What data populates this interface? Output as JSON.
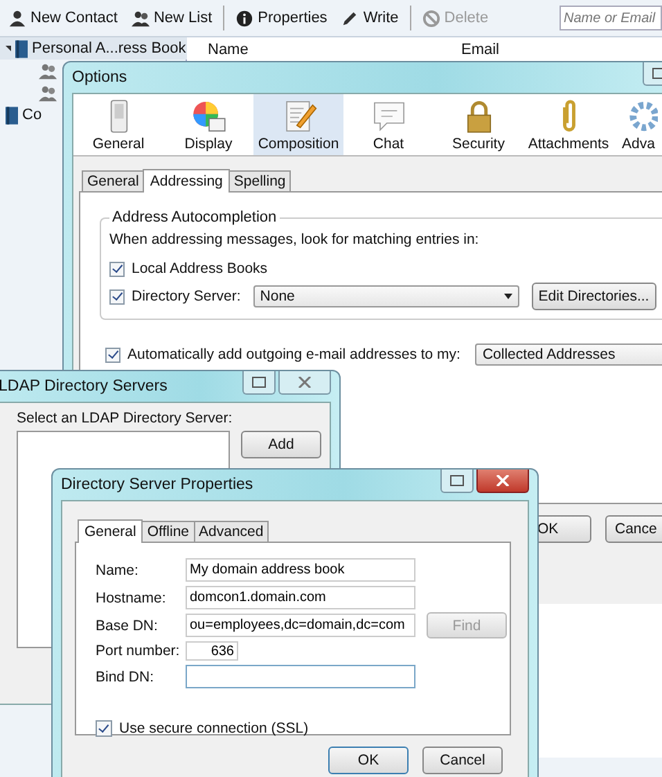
{
  "address_book": {
    "toolbar": [
      {
        "label": "New Contact",
        "disabled": false
      },
      {
        "label": "New List",
        "disabled": false
      },
      {
        "label": "Properties",
        "disabled": false
      },
      {
        "label": "Write",
        "disabled": false
      },
      {
        "label": "Delete",
        "disabled": true
      }
    ],
    "search": {
      "placeholder": "Name or Email"
    },
    "tree": [
      {
        "label": "Personal A...ress Book",
        "selected": true,
        "children": [
          {
            "kind": "list"
          },
          {
            "kind": "list"
          }
        ]
      },
      {
        "label": "Co",
        "selected": false
      }
    ],
    "columns": [
      "Name",
      "Email"
    ]
  },
  "options": {
    "title": "Options",
    "panes": [
      {
        "label": "General",
        "selected": false
      },
      {
        "label": "Display",
        "selected": false
      },
      {
        "label": "Composition",
        "selected": true
      },
      {
        "label": "Chat",
        "selected": false
      },
      {
        "label": "Security",
        "selected": false
      },
      {
        "label": "Attachments",
        "selected": false
      },
      {
        "label": "Adva",
        "selected": false
      }
    ],
    "tabs": [
      {
        "label": "General",
        "selected": false
      },
      {
        "label": "Addressing",
        "selected": true
      },
      {
        "label": "Spelling",
        "selected": false
      }
    ],
    "group": "Address Autocompletion",
    "prompt": "When addressing messages, look for matching entries in:",
    "local_books": {
      "label": "Local Address Books",
      "checked": true
    },
    "directory_server": {
      "label": "Directory Server:",
      "checked": true,
      "value": "None"
    },
    "edit_button": "Edit Directories...",
    "auto_add": {
      "label": "Automatically add outgoing e-mail addresses to my:",
      "checked": true,
      "value": "Collected Addresses"
    },
    "buttons": [
      "OK",
      "Cance"
    ]
  },
  "ldap": {
    "title": "LDAP Directory Servers",
    "label": "Select an LDAP Directory Server:",
    "buttons": [
      "Add"
    ]
  },
  "properties": {
    "title": "Directory Server Properties",
    "tabs": [
      {
        "label": "General",
        "selected": true
      },
      {
        "label": "Offline",
        "selected": false
      },
      {
        "label": "Advanced",
        "selected": false
      }
    ],
    "fields": [
      {
        "label": "Name:",
        "value": "My domain address book"
      },
      {
        "label": "Hostname:",
        "value": "domcon1.domain.com"
      },
      {
        "label": "Base DN:",
        "value": "ou=employees,dc=domain,dc=com"
      },
      {
        "label": "Port number:",
        "value": "636"
      },
      {
        "label": "Bind DN:"
      }
    ],
    "find_button": {
      "label": "Find",
      "disabled": true
    },
    "ssl": {
      "label": "Use secure connection (SSL)",
      "checked": true
    },
    "buttons": [
      "OK",
      "Cancel"
    ]
  }
}
